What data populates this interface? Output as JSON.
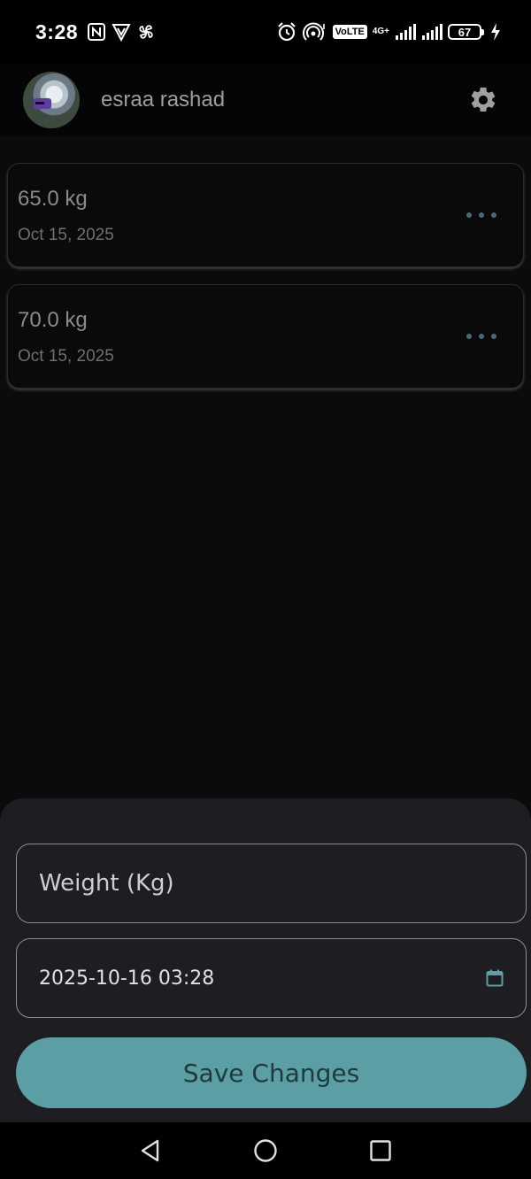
{
  "status_bar": {
    "time": "3:28",
    "volte": "VoLTE",
    "network": "4G+",
    "battery": "67"
  },
  "header": {
    "user_name": "esraa rashad"
  },
  "entries": [
    {
      "weight": "65.0 kg",
      "date": "Oct 15, 2025"
    },
    {
      "weight": "70.0 kg",
      "date": "Oct 15, 2025"
    }
  ],
  "form": {
    "weight_placeholder": "Weight (Kg)",
    "date_value": "2025-10-16 03:28",
    "save_label": "Save Changes"
  },
  "colors": {
    "accent": "#5b9ea3",
    "background": "#0b0b0b",
    "sheet": "#1e1d22"
  },
  "icons": [
    "nfc-icon",
    "vpn-icon",
    "pinwheel-icon",
    "alarm-icon",
    "hotspot-icon",
    "signal-icon",
    "battery-icon",
    "charging-icon",
    "avatar",
    "gear-icon",
    "more-horizontal-icon",
    "calendar-icon",
    "back-icon",
    "home-icon",
    "recents-icon"
  ]
}
